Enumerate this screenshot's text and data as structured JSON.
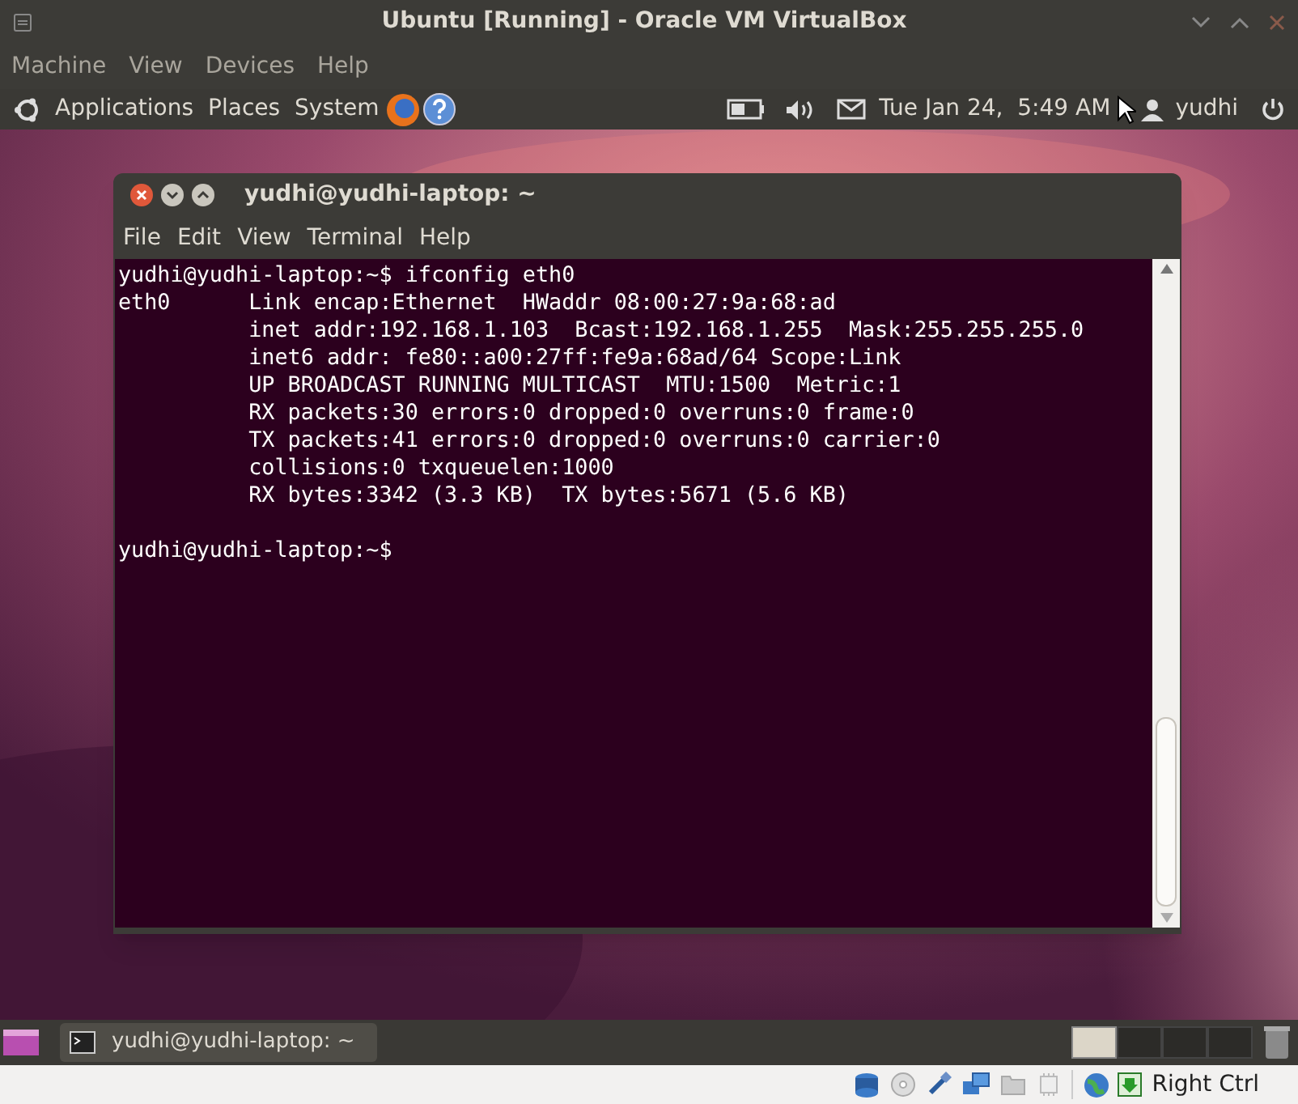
{
  "window": {
    "title": "Ubuntu [Running] - Oracle VM VirtualBox"
  },
  "menu": [
    "Machine",
    "View",
    "Devices",
    "Help"
  ],
  "top_panel": {
    "menus": [
      "Applications",
      "Places",
      "System"
    ],
    "clock": "Tue Jan 24,  5:49 AM",
    "user": "yudhi"
  },
  "terminal": {
    "title": "yudhi@yudhi-laptop: ~",
    "menu": [
      "File",
      "Edit",
      "View",
      "Terminal",
      "Help"
    ],
    "blocks": [
      [
        "yudhi@yudhi-laptop:~$ ifconfig eth0",
        "eth0      Link encap:Ethernet  HWaddr 08:00:27:9a:68:ad  ",
        "          inet addr:192.168.1.103  Bcast:192.168.1.255  Mask:255.255.255.0",
        "          inet6 addr: fe80::a00:27ff:fe9a:68ad/64 Scope:Link",
        "          UP BROADCAST RUNNING MULTICAST  MTU:1500  Metric:1",
        "          RX packets:30 errors:0 dropped:0 overruns:0 frame:0",
        "          TX packets:41 errors:0 dropped:0 overruns:0 carrier:0",
        "          collisions:0 txqueuelen:1000 ",
        "          RX bytes:3342 (3.3 KB)  TX bytes:5671 (5.6 KB)"
      ],
      [
        "yudhi@yudhi-laptop:~$ "
      ]
    ]
  },
  "taskbar": {
    "tasks": [
      {
        "label": "yudhi@yudhi-laptop: ~",
        "selected": false
      }
    ]
  },
  "status_bar": {
    "host_key": "Right Ctrl"
  }
}
